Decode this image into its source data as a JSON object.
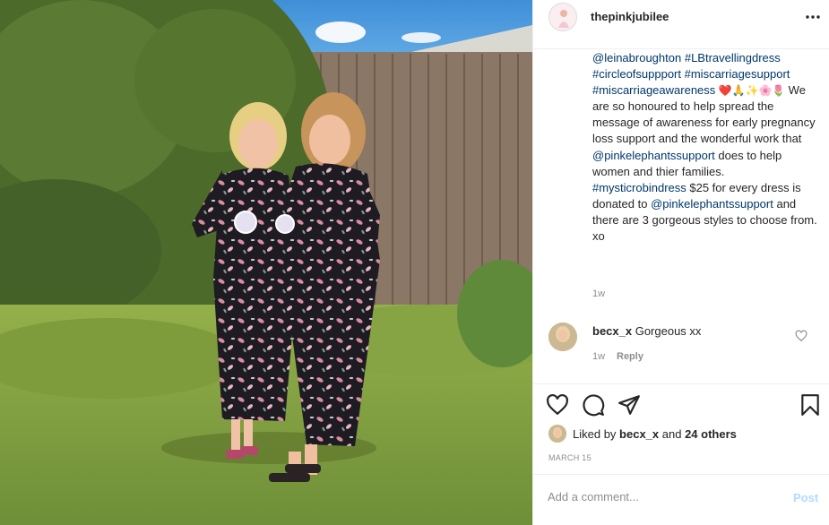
{
  "post": {
    "username": "thepinkjubilee",
    "more_icon": "more-horizontal-icon",
    "caption": {
      "parts": [
        {
          "text": "@leinabroughton",
          "link": true
        },
        {
          "text": " ",
          "link": false
        },
        {
          "text": "#LBtravellingdress",
          "link": true
        },
        {
          "text": " ",
          "link": false
        },
        {
          "text": "#circleofsuppport",
          "link": true
        },
        {
          "text": " ",
          "link": false
        },
        {
          "text": "#miscarriagesupport",
          "link": true
        },
        {
          "text": " ",
          "link": false
        },
        {
          "text": "#miscarriageawareness",
          "link": true
        },
        {
          "text": " ❤️🙏✨🌸🌷 ",
          "link": false,
          "emoji": true
        },
        {
          "text": "We are so honoured to help spread the message of awareness for early pregnancy loss support and the wonderful work that ",
          "link": false
        },
        {
          "text": "@pinkelephantssupport",
          "link": true
        },
        {
          "text": " does to help women and thier families. ",
          "link": false
        },
        {
          "text": "#mysticrobindress",
          "link": true
        },
        {
          "text": " $25 for every dress is donated to ",
          "link": false
        },
        {
          "text": "@pinkelephantssupport",
          "link": true
        },
        {
          "text": " and there are 3 gorgeous styles to choose from. xo",
          "link": false
        }
      ],
      "time": "1w"
    },
    "comment": {
      "username": "becx_x",
      "text": "Gorgeous xx",
      "time": "1w",
      "reply_label": "Reply"
    },
    "actions": {
      "like_icon": "heart-icon",
      "comment_icon": "comment-icon",
      "share_icon": "share-icon",
      "save_icon": "bookmark-icon"
    },
    "likes": {
      "prefix": "Liked by ",
      "user": "becx_x",
      "middle": " and ",
      "others": "24 others"
    },
    "date": "MARCH 15",
    "add_comment": {
      "placeholder": "Add a comment...",
      "post_label": "Post"
    }
  }
}
